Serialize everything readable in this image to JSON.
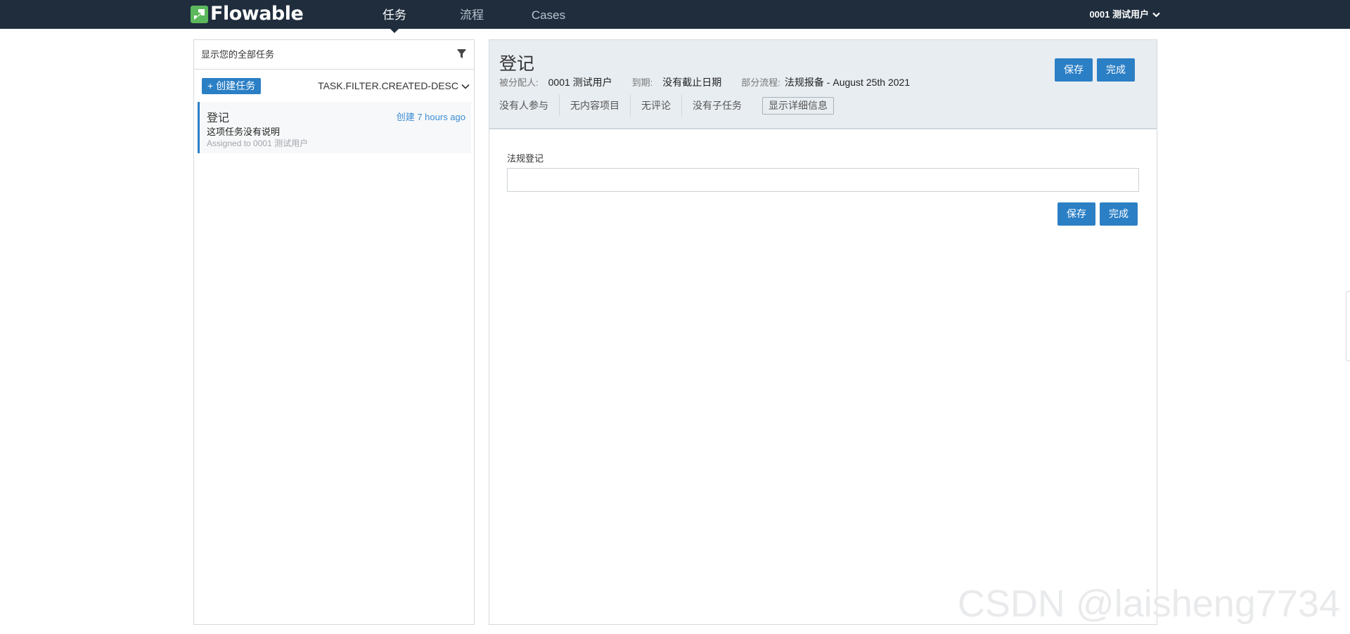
{
  "brand": {
    "name": "Flowable",
    "accent_color": "#2b7fc5",
    "logo_color": "#5cb85c",
    "nav_background": "#1f2d3d"
  },
  "nav": {
    "tabs": [
      {
        "label": "任务",
        "active": true
      },
      {
        "label": "流程",
        "active": false
      },
      {
        "label": "Cases",
        "active": false
      }
    ],
    "user_label": "0001 测试用户",
    "user_icon": "chevron-down-icon"
  },
  "task_list": {
    "filter_text": "显示您的全部任务",
    "filter_icon": "filter-icon",
    "create_button": "+ 创建任务",
    "sort_label": "TASK.FILTER.CREATED-DESC",
    "items": [
      {
        "title": "登记",
        "created": "创建 7 hours ago",
        "description": "这项任务没有说明",
        "assigned": "Assigned to 0001 测试用户"
      }
    ]
  },
  "task_detail": {
    "title": "登记",
    "assignee_label": "被分配人:",
    "assignee_value": "0001 测试用户",
    "due_label": "到期:",
    "due_value": "没有截止日期",
    "process_label": "部分流程:",
    "process_value": "法规报备 - August 25th 2021",
    "links": [
      "没有人参与",
      "无内容项目",
      "无评论",
      "没有子任务"
    ],
    "details_button": "显示详细信息",
    "save_button": "保存",
    "complete_button": "完成"
  },
  "form": {
    "field_label": "法规登记",
    "field_value": "",
    "save_button": "保存",
    "complete_button": "完成"
  },
  "watermark": "CSDN @laisheng7734"
}
